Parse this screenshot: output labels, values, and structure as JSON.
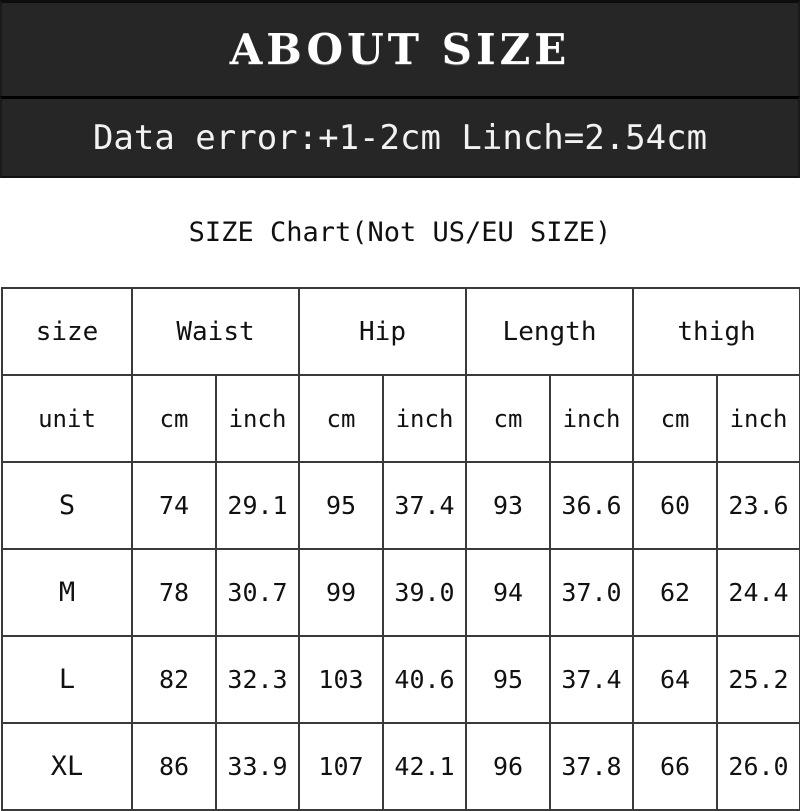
{
  "banner": {
    "title": "ABOUT SIZE",
    "note": "Data error:+1-2cm Linch=2.54cm"
  },
  "caption": {
    "text": "SIZE Chart(Not US/EU SIZE)"
  },
  "colors": {
    "banner_bg": "#262626",
    "banner_text": "#ffffff",
    "table_border": "#3a3a3a",
    "table_bg": "#ffffff",
    "table_text": "#111111"
  },
  "table": {
    "group_headers": [
      "size",
      "Waist",
      "Hip",
      "Length",
      "thigh"
    ],
    "unit_row": [
      "unit",
      "cm",
      "inch",
      "cm",
      "inch",
      "cm",
      "inch",
      "cm",
      "inch"
    ],
    "rows": [
      {
        "size": "S",
        "waist_cm": "74",
        "waist_inch": "29.1",
        "hip_cm": "95",
        "hip_inch": "37.4",
        "length_cm": "93",
        "length_inch": "36.6",
        "thigh_cm": "60",
        "thigh_inch": "23.6"
      },
      {
        "size": "M",
        "waist_cm": "78",
        "waist_inch": "30.7",
        "hip_cm": "99",
        "hip_inch": "39.0",
        "length_cm": "94",
        "length_inch": "37.0",
        "thigh_cm": "62",
        "thigh_inch": "24.4"
      },
      {
        "size": "L",
        "waist_cm": "82",
        "waist_inch": "32.3",
        "hip_cm": "103",
        "hip_inch": "40.6",
        "length_cm": "95",
        "length_inch": "37.4",
        "thigh_cm": "64",
        "thigh_inch": "25.2"
      },
      {
        "size": "XL",
        "waist_cm": "86",
        "waist_inch": "33.9",
        "hip_cm": "107",
        "hip_inch": "42.1",
        "length_cm": "96",
        "length_inch": "37.8",
        "thigh_cm": "66",
        "thigh_inch": "26.0"
      }
    ]
  }
}
